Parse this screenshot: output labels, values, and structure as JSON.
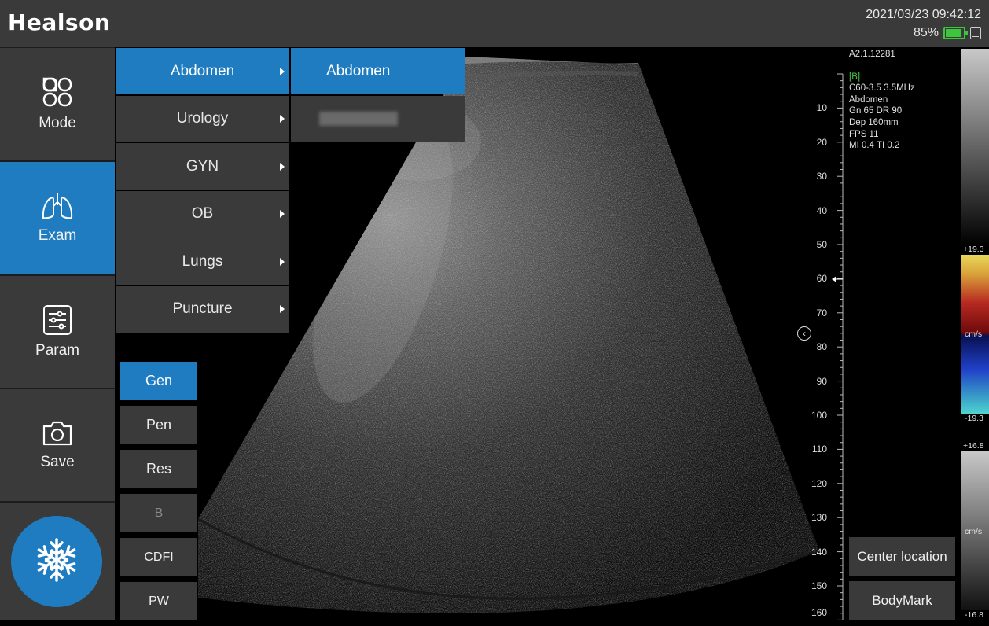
{
  "header": {
    "brand": "Healson",
    "datetime": "2021/03/23 09:42:12",
    "battery_percent_label": "85%",
    "battery_level": 0.85
  },
  "sidebar": {
    "items": [
      {
        "label": "Mode",
        "icon": "mode-grid-icon"
      },
      {
        "label": "Exam",
        "icon": "lungs-icon",
        "active": true
      },
      {
        "label": "Param",
        "icon": "sliders-icon"
      },
      {
        "label": "Save",
        "icon": "camera-icon"
      }
    ],
    "freeze_icon": "snowflake-icon"
  },
  "exam_menu": {
    "items": [
      {
        "label": "Abdomen",
        "active": true
      },
      {
        "label": "Urology"
      },
      {
        "label": "GYN"
      },
      {
        "label": "OB"
      },
      {
        "label": "Lungs"
      },
      {
        "label": "Puncture"
      }
    ],
    "submenu": [
      {
        "label": "Abdomen",
        "active": true
      }
    ]
  },
  "imaging_modes": [
    {
      "label": "Gen",
      "active": true
    },
    {
      "label": "Pen"
    },
    {
      "label": "Res"
    },
    {
      "label": "B",
      "disabled": true
    },
    {
      "label": "CDFI"
    },
    {
      "label": "PW"
    }
  ],
  "probe_info": {
    "version": "A2.1.12281",
    "mode_tag": "[B]",
    "probe": "C60-3.5  3.5MHz",
    "preset": "Abdomen",
    "gain_dr": "Gn 65  DR 90",
    "depth": "Dep 160mm",
    "fps": "FPS 11",
    "mi_ti": "MI 0.4  TI 0.2"
  },
  "depth_scale": [
    "10",
    "20",
    "30",
    "40",
    "50",
    "60",
    "70",
    "80",
    "90",
    "100",
    "110",
    "120",
    "130",
    "140",
    "150",
    "160"
  ],
  "color_scale": {
    "cfm_max": "+19.3",
    "cfm_unit": "cm/s",
    "cfm_min": "-19.3",
    "pw_max": "+16.8",
    "pw_unit": "cm/s",
    "pw_min": "-16.8",
    "accent": "#1f7cc1"
  },
  "right_buttons": {
    "center_location": "Center location",
    "body_mark": "BodyMark"
  }
}
